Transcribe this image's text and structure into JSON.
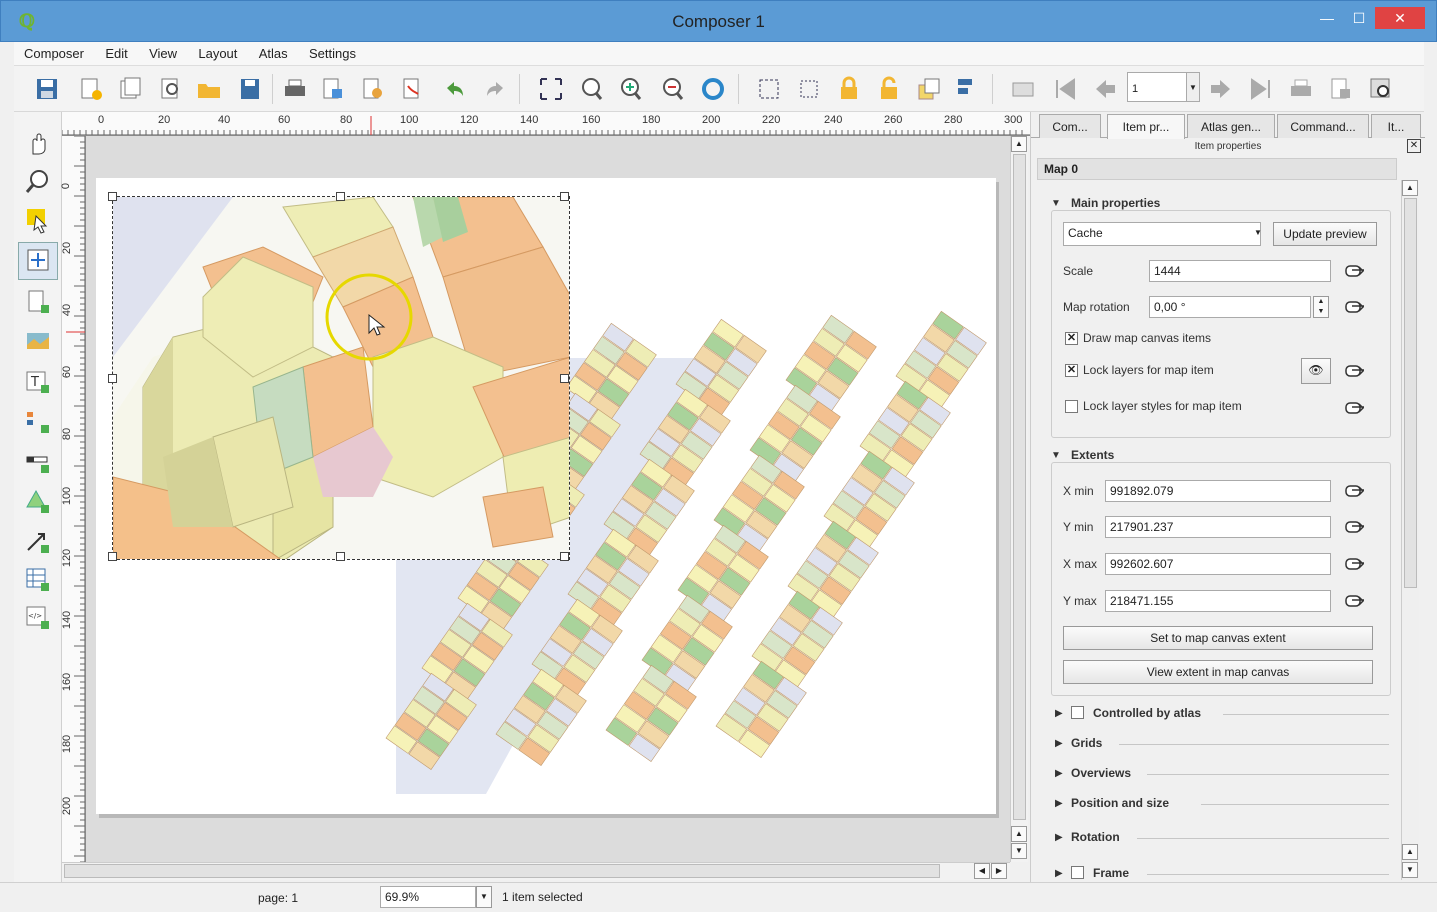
{
  "window": {
    "title": "Composer 1"
  },
  "menu": [
    "Composer",
    "Edit",
    "View",
    "Layout",
    "Atlas",
    "Settings"
  ],
  "toolbar": {
    "page_value": "1"
  },
  "ruler": {
    "h_ticks": [
      "0",
      "20",
      "40",
      "60",
      "80",
      "100",
      "120",
      "140",
      "160",
      "180",
      "200",
      "220",
      "240",
      "260",
      "280",
      "300"
    ],
    "v_ticks": [
      "0",
      "20",
      "40",
      "60",
      "80",
      "100",
      "120",
      "140",
      "160",
      "180",
      "200"
    ]
  },
  "panel": {
    "tabs": [
      "Com...",
      "Item pr...",
      "Atlas gen...",
      "Command...",
      "It..."
    ],
    "subtitle": "Item properties",
    "item_title": "Map 0",
    "main": {
      "title": "Main properties",
      "cache": "Cache",
      "update_preview": "Update preview",
      "scale_label": "Scale",
      "scale_value": "1444",
      "rotation_label": "Map rotation",
      "rotation_value": "0,00 °",
      "draw_items": "Draw map canvas items",
      "lock_layers": "Lock layers for map item",
      "lock_styles": "Lock layer styles for map item"
    },
    "extents": {
      "title": "Extents",
      "xmin_label": "X min",
      "xmin": "991892.079",
      "ymin_label": "Y min",
      "ymin": "217901.237",
      "xmax_label": "X max",
      "xmax": "992602.607",
      "ymax_label": "Y max",
      "ymax": "218471.155",
      "set_extent": "Set to map canvas extent",
      "view_extent": "View extent in map canvas"
    },
    "sections": [
      "Controlled by atlas",
      "Grids",
      "Overviews",
      "Position and size",
      "Rotation",
      "Frame"
    ]
  },
  "status": {
    "page": "page: 1",
    "zoom": "69.9%",
    "selection": "1 item selected"
  }
}
